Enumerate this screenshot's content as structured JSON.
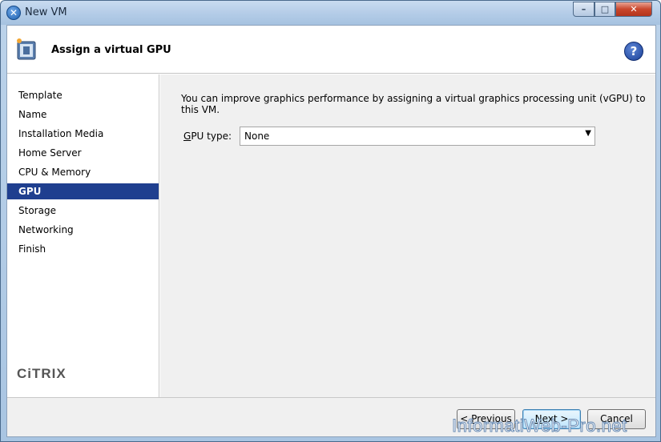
{
  "window": {
    "title": "New VM"
  },
  "header": {
    "title": "Assign a virtual GPU"
  },
  "sidebar": {
    "items": [
      {
        "label": "Template"
      },
      {
        "label": "Name"
      },
      {
        "label": "Installation Media"
      },
      {
        "label": "Home Server"
      },
      {
        "label": "CPU & Memory"
      },
      {
        "label": "GPU",
        "selected": true
      },
      {
        "label": "Storage"
      },
      {
        "label": "Networking"
      },
      {
        "label": "Finish"
      }
    ],
    "logo": "CiTRIX"
  },
  "main": {
    "info": "You can improve graphics performance by assigning a virtual graphics processing unit (vGPU) to this VM.",
    "gpu_label_access": "G",
    "gpu_label_rest": "PU type:",
    "gpu_value": "None"
  },
  "footer": {
    "prev_prefix": "< ",
    "prev_access": "P",
    "prev_rest": "revious",
    "next_access": "N",
    "next_rest": "ext >",
    "cancel": "Cancel"
  },
  "watermark": "InformatiWeb-Pro.net",
  "colors": {
    "selected": "#1f3f8f",
    "close": "#c9462c"
  }
}
